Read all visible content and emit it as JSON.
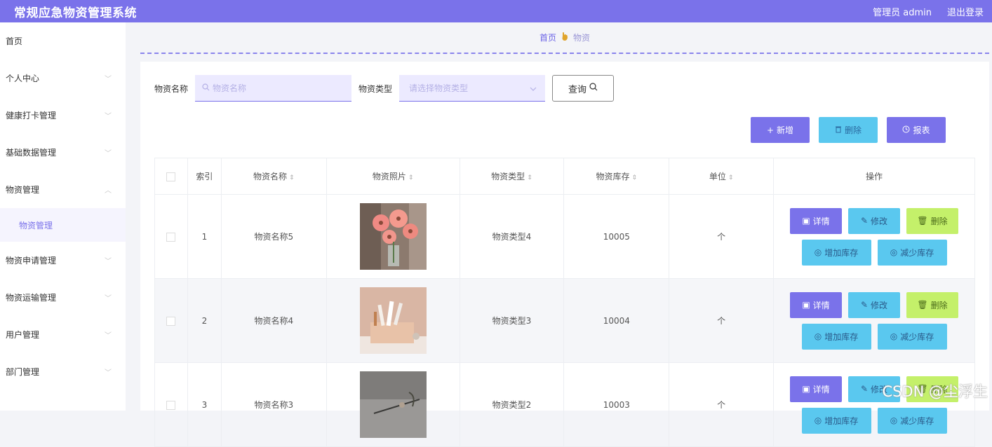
{
  "header": {
    "title": "常规应急物资管理系统",
    "user": "管理员 admin",
    "logout": "退出登录"
  },
  "sidebar": {
    "items": [
      {
        "label": "首页",
        "chev": ""
      },
      {
        "label": "个人中心",
        "chev": "﹀"
      },
      {
        "label": "健康打卡管理",
        "chev": "﹀"
      },
      {
        "label": "基础数据管理",
        "chev": "﹀"
      },
      {
        "label": "物资管理",
        "chev": "︿"
      },
      {
        "label": "物资申请管理",
        "chev": "﹀"
      },
      {
        "label": "物资运输管理",
        "chev": "﹀"
      },
      {
        "label": "用户管理",
        "chev": "﹀"
      },
      {
        "label": "部门管理",
        "chev": "﹀"
      }
    ],
    "sub": {
      "label": "物资管理"
    }
  },
  "breadcrumb": {
    "home": "首页",
    "current": "物资"
  },
  "search": {
    "name_label": "物资名称",
    "name_placeholder": "物资名称",
    "type_label": "物资类型",
    "type_placeholder": "请选择物资类型",
    "query_label": "查询"
  },
  "actions": {
    "add": "新增",
    "delete": "删除",
    "report": "报表"
  },
  "table": {
    "headers": [
      "索引",
      "物资名称",
      "物资照片",
      "物资类型",
      "物资库存",
      "单位",
      "操作"
    ],
    "rows": [
      {
        "index": "1",
        "name": "物资名称5",
        "type": "物资类型4",
        "stock": "10005",
        "unit": "个",
        "photo": "pink-gerbera-flowers"
      },
      {
        "index": "2",
        "name": "物资名称4",
        "type": "物资类型3",
        "stock": "10004",
        "unit": "个",
        "photo": "desk-organizer-with-pens"
      },
      {
        "index": "3",
        "name": "物资名称3",
        "type": "物资类型2",
        "stock": "10003",
        "unit": "个",
        "photo": "grey-still-life"
      }
    ],
    "ops": {
      "detail": "详情",
      "edit": "修改",
      "delete": "删除",
      "add_stock": "增加库存",
      "reduce_stock": "减少库存"
    }
  },
  "watermark": "CSDN @尘浮生",
  "colors": {
    "primary": "#7a72ea",
    "info": "#5ac8ef",
    "success": "#c4f06a"
  }
}
